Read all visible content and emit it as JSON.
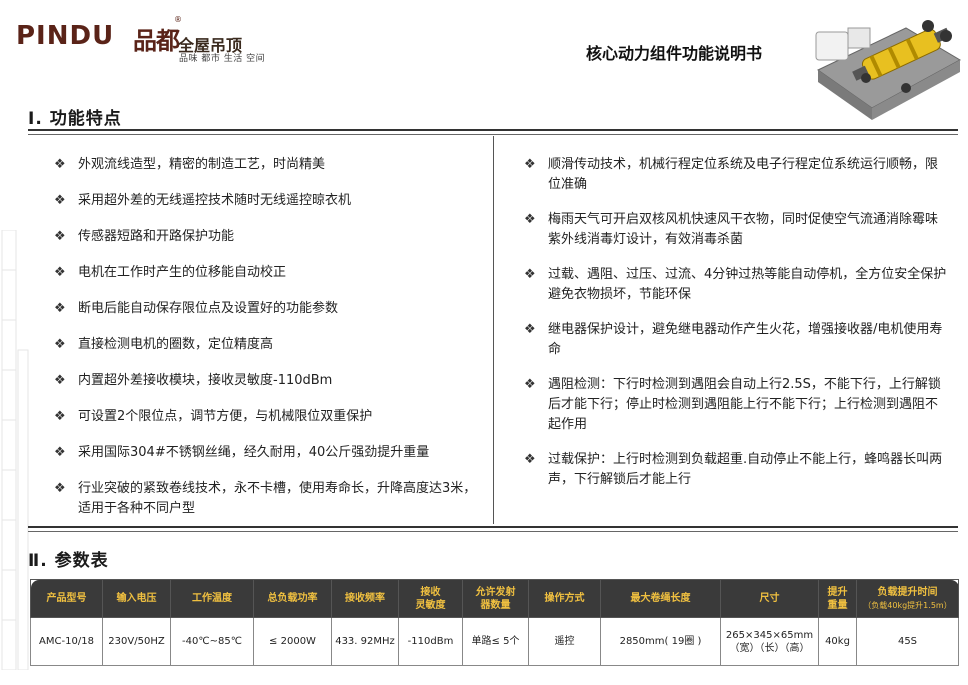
{
  "header": {
    "brand_en": "PINDU",
    "brand_cn": "品都",
    "reg_mark": "®",
    "brand_suffix": "全屋吊顶",
    "tagline": "品味 都市 生活 空间",
    "doc_title": "核心动力组件功能说明书"
  },
  "section1": {
    "heading": "Ⅰ. 功能特点",
    "bullet": "❖",
    "left_items": [
      "外观流线造型，精密的制造工艺，时尚精美",
      "采用超外差的无线遥控技术随时无线遥控晾衣机",
      "传感器短路和开路保护功能",
      "电机在工作时产生的位移能自动校正",
      "断电后能自动保存限位点及设置好的功能参数",
      "直接检测电机的圈数，定位精度高",
      "内置超外差接收模块，接收灵敏度-110dBm",
      "可设置2个限位点，调节方便，与机械限位双重保护",
      "采用国际304#不锈钢丝绳，经久耐用，40公斤强劲提升重量",
      "行业突破的紧致卷线技术，永不卡槽，使用寿命长，升降高度达3米，适用于各种不同户型"
    ],
    "right_items": [
      "顺滑传动技术，机械行程定位系统及电子行程定位系统运行顺畅，限位准确",
      "梅雨天气可开启双核风机快速风干衣物，同时促使空气流通消除霉味紫外线消毒灯设计，有效消毒杀菌",
      "过载、遇阻、过压、过流、4分钟过热等能自动停机，全方位安全保护避免衣物损坏，节能环保",
      "继电器保护设计，避免继电器动作产生火花，增强接收器/电机使用寿命",
      "遇阻检测：下行时检测到遇阻会自动上行2.5S，不能下行，上行解锁后才能下行；停止时检测到遇阻能上行不能下行；上行检测到遇阻不起作用",
      "过载保护：上行时检测到负载超重.自动停止不能上行，蜂鸣器长叫两声，下行解锁后才能上行"
    ]
  },
  "section2": {
    "heading": "Ⅱ. 参数表",
    "columns": [
      {
        "label": "产品型号",
        "sub": ""
      },
      {
        "label": "输入电压",
        "sub": ""
      },
      {
        "label": "工作温度",
        "sub": ""
      },
      {
        "label": "总负载功率",
        "sub": ""
      },
      {
        "label": "接收频率",
        "sub": ""
      },
      {
        "label": "接收\n灵敏度",
        "sub": ""
      },
      {
        "label": "允许发射\n器数量",
        "sub": ""
      },
      {
        "label": "操作方式",
        "sub": ""
      },
      {
        "label": "最大卷绳长度",
        "sub": ""
      },
      {
        "label": "尺寸",
        "sub": ""
      },
      {
        "label": "提升\n重量",
        "sub": ""
      },
      {
        "label": "负载提升时间",
        "sub": "（负载40kg提升1.5m）"
      }
    ],
    "row": [
      "AMC-10/18",
      "230V/50HZ",
      "-40℃~85℃",
      "≤ 2000W",
      "433. 92MHz",
      "-110dBm",
      "单路≤ 5个",
      "遥控",
      "2850mm( 19圈 )",
      "265×345×65mm\n（宽）（长）（高）",
      "40kg",
      "45S"
    ]
  },
  "colors": {
    "brand": "#5a2318",
    "table_header_bg": "#3a3a3a",
    "table_header_text": "#f0c040",
    "rule": "#333333"
  },
  "icons": {
    "product": "motor-assembly-illustration",
    "bullet": "four-diamond-bullet-icon"
  }
}
